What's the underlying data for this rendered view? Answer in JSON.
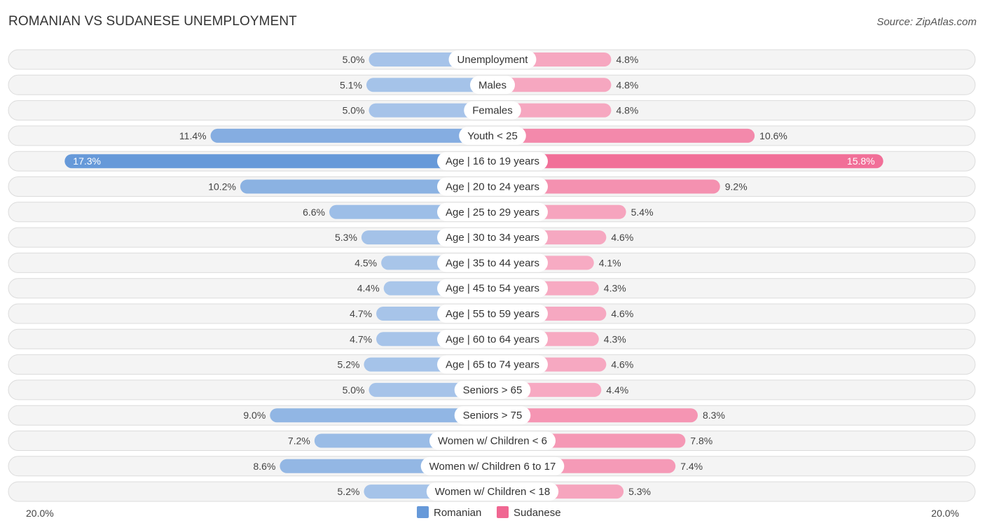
{
  "chart_data": {
    "type": "bar",
    "orientation": "horizontal-diverging",
    "title": "ROMANIAN VS SUDANESE UNEMPLOYMENT",
    "source": "Source: ZipAtlas.com",
    "categories": [
      "Unemployment",
      "Males",
      "Females",
      "Youth < 25",
      "Age | 16 to 19 years",
      "Age | 20 to 24 years",
      "Age | 25 to 29 years",
      "Age | 30 to 34 years",
      "Age | 35 to 44 years",
      "Age | 45 to 54 years",
      "Age | 55 to 59 years",
      "Age | 60 to 64 years",
      "Age | 65 to 74 years",
      "Seniors > 65",
      "Seniors > 75",
      "Women w/ Children < 6",
      "Women w/ Children 6 to 17",
      "Women w/ Children < 18"
    ],
    "series": [
      {
        "name": "Romanian",
        "color": "#6699d9",
        "values": [
          5.0,
          5.1,
          5.0,
          11.4,
          17.3,
          10.2,
          6.6,
          5.3,
          4.5,
          4.4,
          4.7,
          4.7,
          5.2,
          5.0,
          9.0,
          7.2,
          8.6,
          5.2
        ]
      },
      {
        "name": "Sudanese",
        "color": "#f06792",
        "values": [
          4.8,
          4.8,
          4.8,
          10.6,
          15.8,
          9.2,
          5.4,
          4.6,
          4.1,
          4.3,
          4.6,
          4.3,
          4.6,
          4.4,
          8.3,
          7.8,
          7.4,
          5.3
        ]
      }
    ],
    "value_suffix": "%",
    "axis_min_label": "20.0%",
    "axis_max_label": "20.0%",
    "xlim": [
      -20,
      20
    ],
    "legend": [
      "Romanian",
      "Sudanese"
    ],
    "legend_position": "bottom-center",
    "grid": false
  }
}
